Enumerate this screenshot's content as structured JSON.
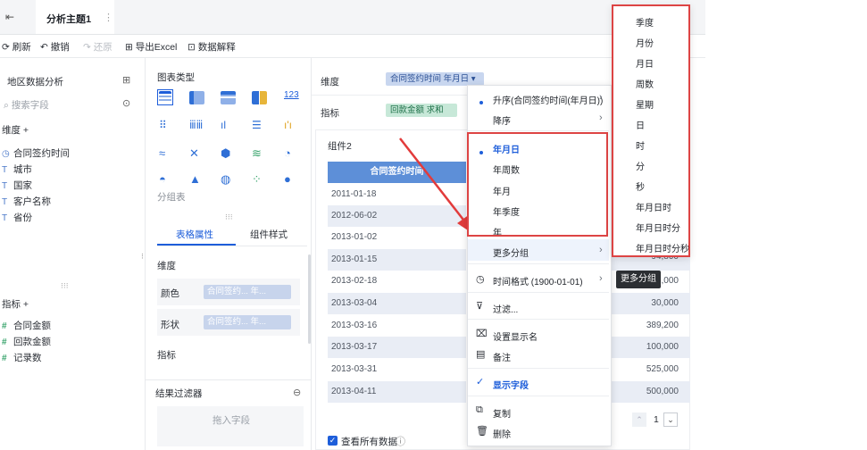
{
  "tabbar": {
    "tab_title": "分析主题1",
    "more": "⋮",
    "back": "⇤"
  },
  "toolbar": {
    "refresh": "刷新",
    "undo": "撤销",
    "redo": "还原",
    "export": "导出Excel",
    "explain": "数据解释"
  },
  "left": {
    "dataset_title": "地区数据分析",
    "search_placeholder": "搜索字段",
    "dimension_header": "维度 +",
    "dimensions": [
      "合同签约时间",
      "城市",
      "国家",
      "客户名称",
      "省份"
    ],
    "measure_header": "指标 +",
    "measures": [
      "合同金额",
      "回款金额",
      "记录数"
    ]
  },
  "middle": {
    "chart_type_label": "图表类型",
    "group_table_label": "分组表",
    "tab_table_attr": "表格属性",
    "tab_component_style": "组件样式",
    "dimension_label": "维度",
    "color_label": "颜色",
    "shape_label": "形状",
    "pill_color": "合同签约... 年...",
    "pill_shape": "合同签约... 年...",
    "measure_label": "指标",
    "result_filter_label": "结果过滤器",
    "drag_field_placeholder": "拖入字段",
    "chart_type_number": "123"
  },
  "right": {
    "dimension_label": "维度",
    "measure_label": "指标",
    "dimension_pill": "合同签约时间 年月日 ▾",
    "measure_pill": "回款金额 求和",
    "component_title": "组件2",
    "table_header": "合同签约时间",
    "rows": [
      "2011-01-18",
      "2012-06-02",
      "2013-01-02",
      "2013-01-15",
      "2013-02-18",
      "2013-03-04",
      "2013-03-16",
      "2013-03-17",
      "2013-03-31",
      "2013-04-11"
    ],
    "right_values": [
      "94,800",
      ",000",
      "30,000",
      "389,200",
      "100,000",
      "525,000",
      "500,000"
    ],
    "page_number": "1",
    "view_all_data": "查看所有数据"
  },
  "menu": {
    "sort_asc": "升序(合同签约时间(年月日))",
    "sort_desc": "降序",
    "group_items": [
      "年月日",
      "年周数",
      "年月",
      "年季度",
      "年"
    ],
    "more_group": "更多分组",
    "time_format": "时间格式 (1900-01-01)",
    "filter": "过滤...",
    "set_display_name": "设置显示名",
    "note": "备注",
    "show_field": "显示字段",
    "copy": "复制",
    "delete": "删除"
  },
  "submenu": {
    "items": [
      "季度",
      "月份",
      "月日",
      "周数",
      "星期",
      "日",
      "时",
      "分",
      "秒",
      "年月日时",
      "年月日时分",
      "年月日时分秒"
    ]
  },
  "tooltip": "更多分组",
  "colors": {
    "accent": "#1e5eda",
    "highlight_red": "#dd4444",
    "table_header": "#5d8fd8"
  }
}
